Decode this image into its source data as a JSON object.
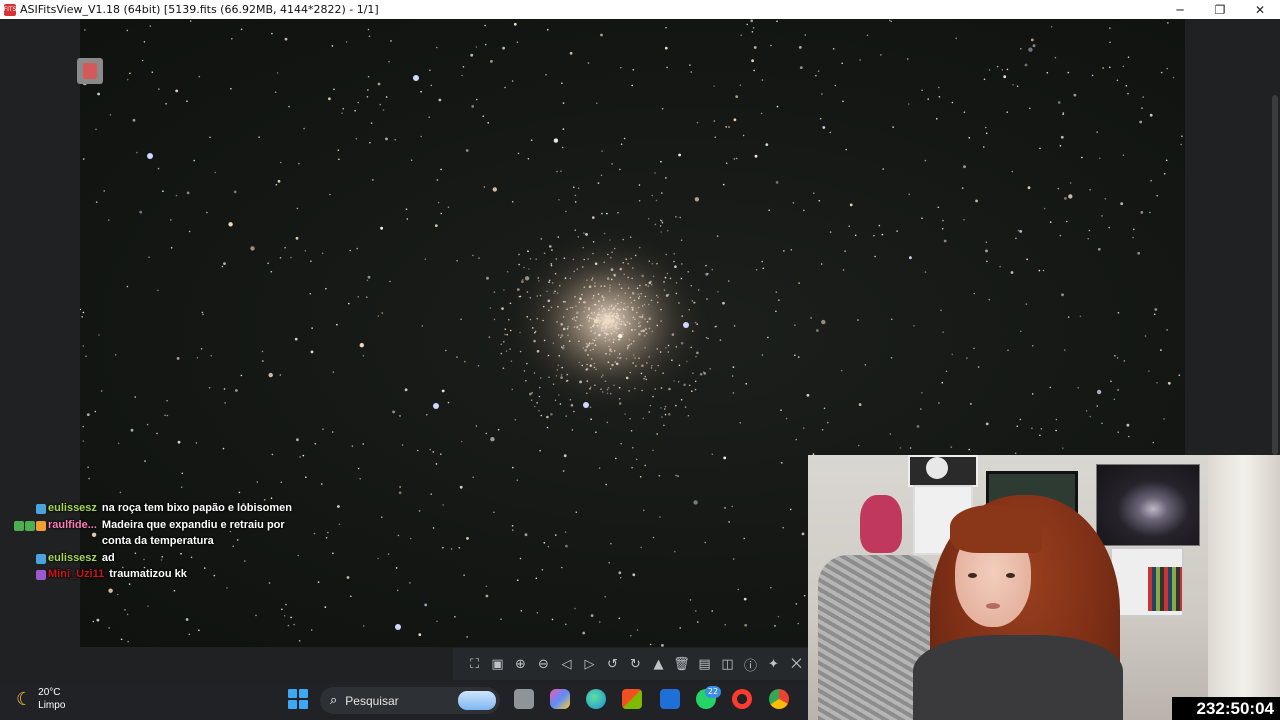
{
  "window": {
    "title": "ASIFitsView_V1.18 (64bit) [5139.fits (66.92MB, 4144*2822) - 1/1]",
    "app_icon_label": "FITS",
    "controls": {
      "minimize": "─",
      "restore": "❐",
      "close": "✕"
    }
  },
  "chat": {
    "messages": [
      {
        "user": "eulissesz",
        "user_color": "#a8d84f",
        "badges": [
          "#4aa3df"
        ],
        "text": "na roça tem bixo papão e lobisomen"
      },
      {
        "user": "raulfide...",
        "user_color": "#ff7ab8",
        "badges": [
          "#4caf50",
          "#4caf50",
          "#f0a030"
        ],
        "text": "Madeira que expandiu e retraiu por conta da temperatura"
      },
      {
        "user": "eulissesz",
        "user_color": "#a8d84f",
        "badges": [
          "#4aa3df"
        ],
        "text": "ad"
      },
      {
        "user": "Mini_Uzi11",
        "user_color": "#d0101a",
        "badges": [
          "#9b59d0"
        ],
        "text": "traumatizou kk"
      }
    ]
  },
  "toolbar": {
    "tools": [
      {
        "name": "fit-window-icon",
        "glyph": "⛶"
      },
      {
        "name": "actual-size-icon",
        "glyph": "▣"
      },
      {
        "name": "zoom-in-icon",
        "glyph": "⊕"
      },
      {
        "name": "zoom-out-icon",
        "glyph": "⊖"
      },
      {
        "name": "previous-icon",
        "glyph": "◁"
      },
      {
        "name": "next-icon",
        "glyph": "▷"
      },
      {
        "name": "rotate-left-icon",
        "glyph": "↺"
      },
      {
        "name": "rotate-right-icon",
        "glyph": "↻"
      },
      {
        "name": "histogram-icon",
        "glyph": "▲"
      },
      {
        "name": "delete-icon",
        "glyph": "🗑"
      },
      {
        "name": "save-icon",
        "glyph": "▤"
      },
      {
        "name": "stretch-icon",
        "glyph": "◫"
      },
      {
        "name": "info-icon",
        "glyph": "ⓘ"
      },
      {
        "name": "star-detect-icon",
        "glyph": "✦"
      },
      {
        "name": "crop-icon",
        "glyph": "⨉"
      }
    ]
  },
  "taskbar": {
    "weather_temp": "20°C",
    "weather_desc": "Limpo",
    "search_placeholder": "Pesquisar",
    "whatsapp_badge": "22"
  },
  "stream": {
    "uptime": "232:50:04"
  }
}
